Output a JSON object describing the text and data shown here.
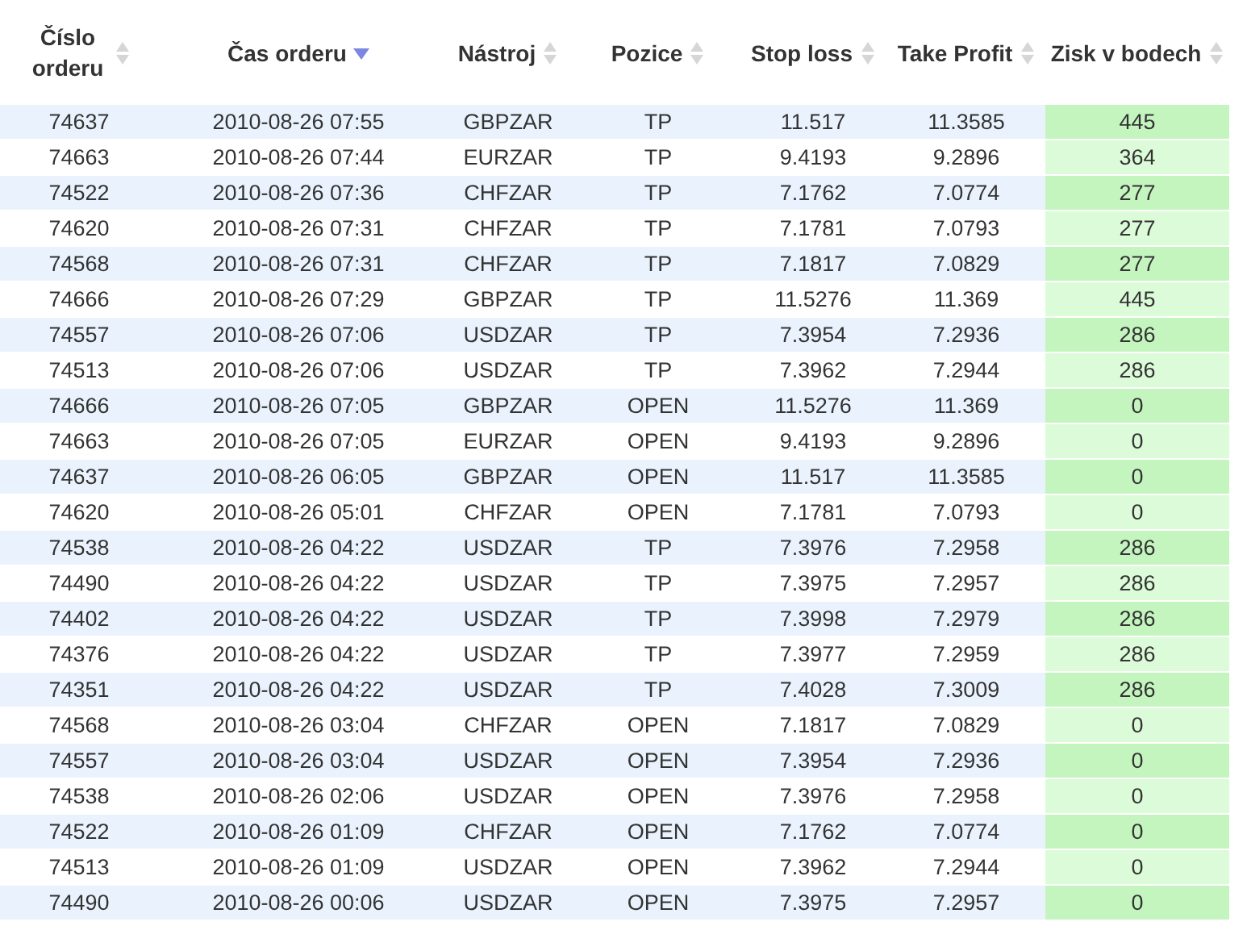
{
  "table": {
    "columns": [
      {
        "label": "Číslo orderu",
        "sorted": false,
        "highlighted": false
      },
      {
        "label": "Čas orderu",
        "sorted": true,
        "highlighted": false
      },
      {
        "label": "Nástroj",
        "sorted": false,
        "highlighted": false
      },
      {
        "label": "Pozice",
        "sorted": false,
        "highlighted": false
      },
      {
        "label": "Stop loss",
        "sorted": false,
        "highlighted": false
      },
      {
        "label": "Take Profit",
        "sorted": false,
        "highlighted": false
      },
      {
        "label": "Zisk v bodech",
        "sorted": false,
        "highlighted": true
      }
    ],
    "rows": [
      [
        "74637",
        "2010-08-26 07:55",
        "GBPZAR",
        "TP",
        "11.517",
        "11.3585",
        "445"
      ],
      [
        "74663",
        "2010-08-26 07:44",
        "EURZAR",
        "TP",
        "9.4193",
        "9.2896",
        "364"
      ],
      [
        "74522",
        "2010-08-26 07:36",
        "CHFZAR",
        "TP",
        "7.1762",
        "7.0774",
        "277"
      ],
      [
        "74620",
        "2010-08-26 07:31",
        "CHFZAR",
        "TP",
        "7.1781",
        "7.0793",
        "277"
      ],
      [
        "74568",
        "2010-08-26 07:31",
        "CHFZAR",
        "TP",
        "7.1817",
        "7.0829",
        "277"
      ],
      [
        "74666",
        "2010-08-26 07:29",
        "GBPZAR",
        "TP",
        "11.5276",
        "11.369",
        "445"
      ],
      [
        "74557",
        "2010-08-26 07:06",
        "USDZAR",
        "TP",
        "7.3954",
        "7.2936",
        "286"
      ],
      [
        "74513",
        "2010-08-26 07:06",
        "USDZAR",
        "TP",
        "7.3962",
        "7.2944",
        "286"
      ],
      [
        "74666",
        "2010-08-26 07:05",
        "GBPZAR",
        "OPEN",
        "11.5276",
        "11.369",
        "0"
      ],
      [
        "74663",
        "2010-08-26 07:05",
        "EURZAR",
        "OPEN",
        "9.4193",
        "9.2896",
        "0"
      ],
      [
        "74637",
        "2010-08-26 06:05",
        "GBPZAR",
        "OPEN",
        "11.517",
        "11.3585",
        "0"
      ],
      [
        "74620",
        "2010-08-26 05:01",
        "CHFZAR",
        "OPEN",
        "7.1781",
        "7.0793",
        "0"
      ],
      [
        "74538",
        "2010-08-26 04:22",
        "USDZAR",
        "TP",
        "7.3976",
        "7.2958",
        "286"
      ],
      [
        "74490",
        "2010-08-26 04:22",
        "USDZAR",
        "TP",
        "7.3975",
        "7.2957",
        "286"
      ],
      [
        "74402",
        "2010-08-26 04:22",
        "USDZAR",
        "TP",
        "7.3998",
        "7.2979",
        "286"
      ],
      [
        "74376",
        "2010-08-26 04:22",
        "USDZAR",
        "TP",
        "7.3977",
        "7.2959",
        "286"
      ],
      [
        "74351",
        "2010-08-26 04:22",
        "USDZAR",
        "TP",
        "7.4028",
        "7.3009",
        "286"
      ],
      [
        "74568",
        "2010-08-26 03:04",
        "CHFZAR",
        "OPEN",
        "7.1817",
        "7.0829",
        "0"
      ],
      [
        "74557",
        "2010-08-26 03:04",
        "USDZAR",
        "OPEN",
        "7.3954",
        "7.2936",
        "0"
      ],
      [
        "74538",
        "2010-08-26 02:06",
        "USDZAR",
        "OPEN",
        "7.3976",
        "7.2958",
        "0"
      ],
      [
        "74522",
        "2010-08-26 01:09",
        "CHFZAR",
        "OPEN",
        "7.1762",
        "7.0774",
        "0"
      ],
      [
        "74513",
        "2010-08-26 01:09",
        "USDZAR",
        "OPEN",
        "7.3962",
        "7.2944",
        "0"
      ],
      [
        "74490",
        "2010-08-26 00:06",
        "USDZAR",
        "OPEN",
        "7.3975",
        "7.2957",
        "0"
      ]
    ]
  }
}
